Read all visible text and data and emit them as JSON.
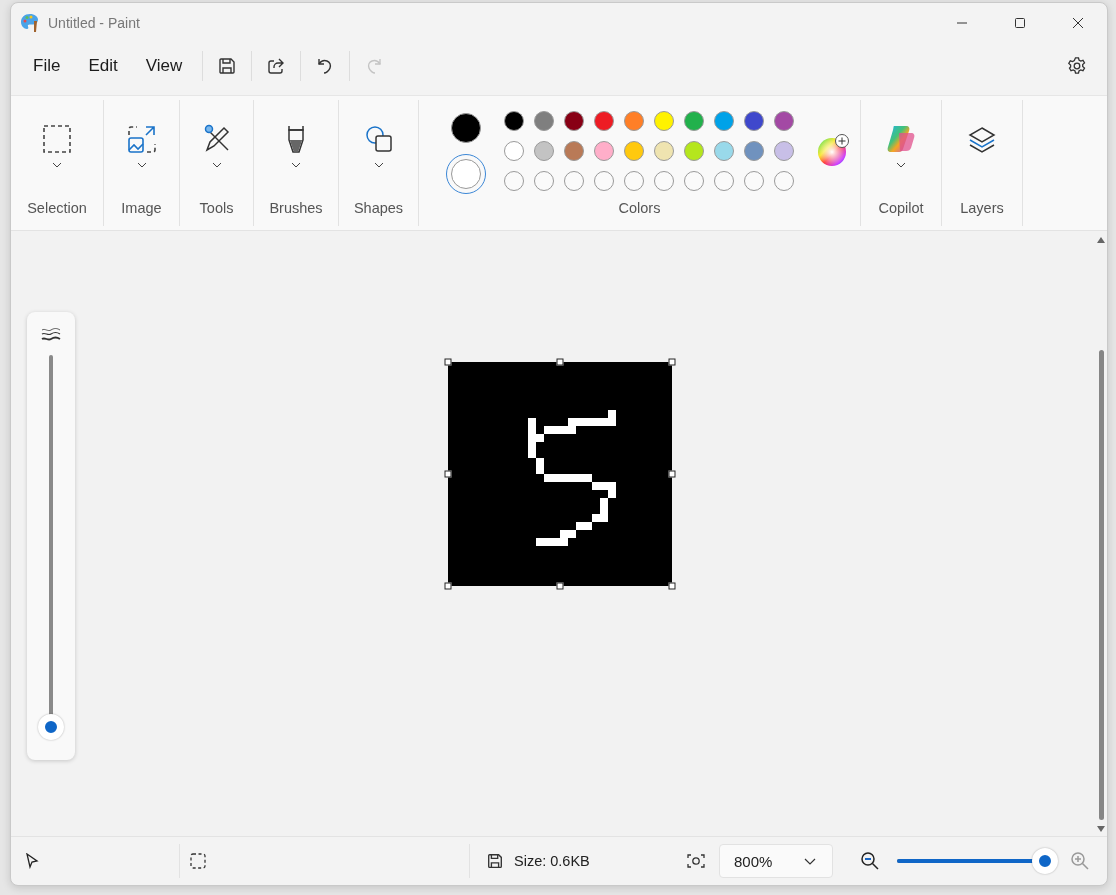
{
  "window": {
    "title": "Untitled - Paint"
  },
  "menu": [
    {
      "label": "File"
    },
    {
      "label": "Edit"
    },
    {
      "label": "View"
    }
  ],
  "quick_actions": [
    {
      "kind": "save",
      "disabled": false
    },
    {
      "kind": "share",
      "disabled": false
    },
    {
      "kind": "undo",
      "disabled": false
    },
    {
      "kind": "redo",
      "disabled": true
    }
  ],
  "ribbon": [
    {
      "kind": "selection",
      "label": "Selection",
      "dropdown": true
    },
    {
      "kind": "image",
      "label": "Image",
      "dropdown": true
    },
    {
      "kind": "tools",
      "label": "Tools",
      "dropdown": true
    },
    {
      "kind": "brushes",
      "label": "Brushes",
      "dropdown": true
    },
    {
      "kind": "shapes",
      "label": "Shapes",
      "dropdown": true
    }
  ],
  "colors": {
    "label": "Colors",
    "primary": {
      "color": "#000000",
      "selected": false
    },
    "secondary": {
      "color": "#ffffff",
      "selected": true
    },
    "palette": [
      [
        {
          "color": "#000000"
        },
        {
          "color": "#7f7f7f"
        },
        {
          "color": "#880015"
        },
        {
          "color": "#ed1c24"
        },
        {
          "color": "#ff7f27"
        },
        {
          "color": "#fff200"
        },
        {
          "color": "#22b14c"
        },
        {
          "color": "#00a2e8"
        },
        {
          "color": "#3f48cc"
        },
        {
          "color": "#a349a4"
        }
      ],
      [
        {
          "color": "#ffffff"
        },
        {
          "color": "#c3c3c3"
        },
        {
          "color": "#b97a57"
        },
        {
          "color": "#ffaec9"
        },
        {
          "color": "#ffc90e"
        },
        {
          "color": "#efe4b0"
        },
        {
          "color": "#b5e61d"
        },
        {
          "color": "#99d9ea"
        },
        {
          "color": "#7092be"
        },
        {
          "color": "#c8bfe7"
        }
      ]
    ],
    "custom_slots": [
      {
        "kind": "empty"
      },
      {
        "kind": "empty"
      },
      {
        "kind": "empty"
      },
      {
        "kind": "empty"
      },
      {
        "kind": "empty"
      },
      {
        "kind": "empty"
      },
      {
        "kind": "empty"
      },
      {
        "kind": "empty"
      },
      {
        "kind": "empty"
      },
      {
        "kind": "empty"
      }
    ]
  },
  "side_groups": [
    {
      "kind": "copilot",
      "label": "Copilot",
      "dropdown": true
    },
    {
      "kind": "layers",
      "label": "Layers",
      "dropdown": false
    }
  ],
  "brush_size": {
    "level": 0
  },
  "status_bar": {
    "size": "Size: 0.6KB",
    "zoom": "800%",
    "zoom_slider": {
      "level": 1
    }
  }
}
